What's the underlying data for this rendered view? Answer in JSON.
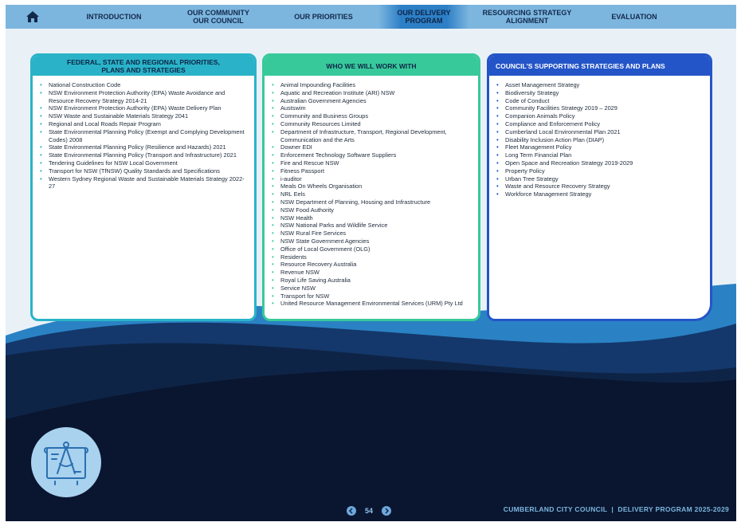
{
  "nav": {
    "items": [
      {
        "label": "INTRODUCTION"
      },
      {
        "label": "OUR COMMUNITY\nOUR COUNCIL"
      },
      {
        "label": "OUR PRIORITIES"
      },
      {
        "label": "OUR DELIVERY\nPROGRAM"
      },
      {
        "label": "RESOURCING STRATEGY\nALIGNMENT"
      },
      {
        "label": "EVALUATION"
      }
    ],
    "active_index": 3
  },
  "cards": [
    {
      "title": "FEDERAL, STATE AND REGIONAL PRIORITIES,\nPLANS AND STRATEGIES",
      "color": "#2ab3c8",
      "items": [
        "National Construction Code",
        "NSW Environment Protection Authority (EPA) Waste Avoidance and Resource Recovery Strategy 2014-21",
        "NSW Environment Protection Authority (EPA) Waste Delivery Plan",
        "NSW Waste and Sustainable Materials Strategy 2041",
        "Regional and Local Roads Repair Program",
        "State Environmental Planning Policy (Exempt and Complying Development Codes) 2008",
        "State Environmental Planning Policy (Resilience and Hazards) 2021",
        "State Environmental Planning Policy (Transport and Infrastructure) 2021",
        "Tendering Guidelines for NSW Local Government",
        "Transport for NSW (TfNSW) Quality Standards and Specifications",
        "Western Sydney Regional Waste and Sustainable Materials Strategy 2022-27"
      ]
    },
    {
      "title": "WHO WE WILL WORK WITH",
      "color": "#38c99a",
      "items": [
        "Animal Impounding Facilities",
        "Aquatic and Recreation Institute (ARI) NSW",
        "Australian Government Agencies",
        "Austswim",
        "Community and Business Groups",
        "Community Resources Limited",
        "Department of Infrastructure, Transport, Regional Development, Communication and the Arts",
        "Downer EDI",
        "Enforcement Technology Software Suppliers",
        "Fire and Rescue NSW",
        "Fitness Passport",
        "i-auditor",
        "Meals On Wheels Organisation",
        "NRL Eels",
        "NSW Department of Planning, Housing and Infrastructure",
        "NSW Food Authority",
        "NSW Health",
        "NSW National Parks and Wildlife Service",
        "NSW Rural Fire Services",
        "NSW State Government Agencies",
        "Office of Local Government (OLG)",
        "Residents",
        "Resource Recovery Australia",
        "Revenue NSW",
        "Royal Life Saving Australia",
        "Service NSW",
        "Transport for NSW",
        "United Resource Management Environmental Services (URM) Pty Ltd"
      ]
    },
    {
      "title": "COUNCIL'S SUPPORTING STRATEGIES AND PLANS",
      "color": "#2455c8",
      "items": [
        "Asset Management Strategy",
        "Biodiversity Strategy",
        "Code of Conduct",
        "Community Facilities Strategy 2019 – 2029",
        "Companion Animals Policy",
        "Compliance and Enforcement Policy",
        "Cumberland Local Environmental Plan 2021",
        "Disability Inclusion Action Plan (DIAP)",
        "Fleet Management Policy",
        "Long Term Financial Plan",
        "Open Space and Recreation Strategy 2019-2029",
        "Property Policy",
        "Urban Tree Strategy",
        "Waste and Resource Recovery Strategy",
        "Workforce Management Strategy"
      ]
    }
  ],
  "footer": {
    "page_number": "54",
    "prev_icon": "chevron-left-icon",
    "next_icon": "chevron-right-icon",
    "title": "CUMBERLAND CITY COUNCIL  |  DELIVERY PROGRAM 2025-2029"
  },
  "icons": {
    "home": "home-icon",
    "blueprint": "blueprint-compass-icon"
  },
  "colors": {
    "nav_bg": "#7cb6df",
    "navy": "#0d1a33",
    "wave_blue": "#2a82c4"
  }
}
